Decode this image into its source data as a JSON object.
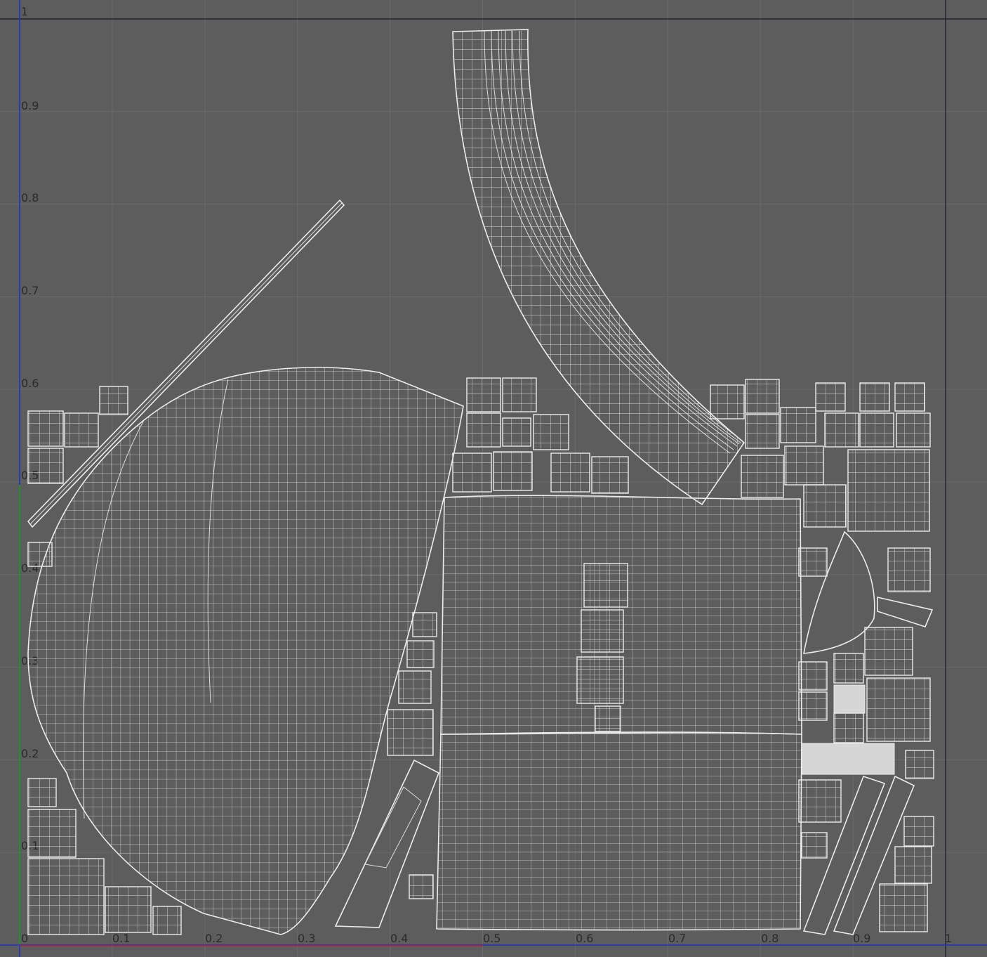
{
  "editor": {
    "view": "UV Editor",
    "background_color": "#5d5d5d",
    "wire_color": "#dcdcdc",
    "u_axis_color": "#c82020",
    "v_axis_color": "#20a020",
    "border_axis_color": "#2030c0"
  },
  "axes": {
    "u_ticks": [
      "0",
      "0.1",
      "0.2",
      "0.3",
      "0.4",
      "0.5",
      "0.6",
      "0.7",
      "0.8",
      "0.9",
      "1"
    ],
    "v_ticks": [
      "0.1",
      "0.2",
      "0.3",
      "0.4",
      "0.5",
      "0.6",
      "0.7",
      "0.8",
      "0.9",
      "1"
    ]
  },
  "uv_islands": {
    "large_sphere_shell": "uv-island",
    "curved_tube_strip": "uv-island",
    "diagonal_rod": "uv-island",
    "top_panel": "uv-island",
    "bottom_panel": "uv-island",
    "small_block_islands": "uv-island"
  }
}
